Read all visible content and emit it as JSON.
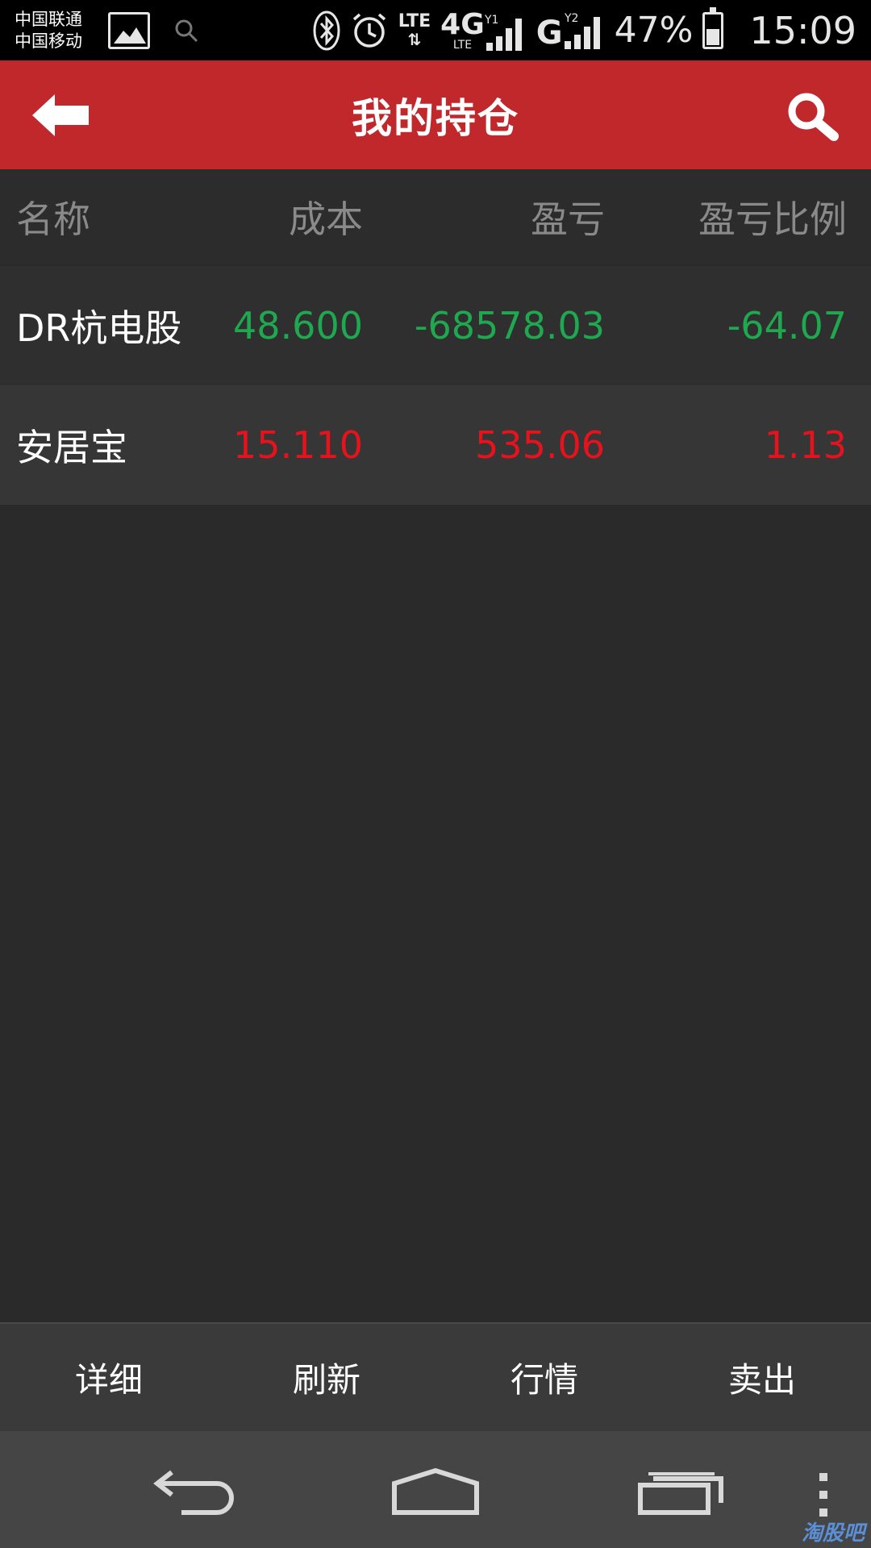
{
  "status_bar": {
    "carrier1": "中国联通",
    "carrier2": "中国移动",
    "lte_label": "LTE",
    "network_4g": "4G",
    "network_4g_sub": "LTE",
    "network_g": "G",
    "battery_percent": "47%",
    "time": "15:09"
  },
  "header": {
    "title": "我的持仓"
  },
  "columns": {
    "name": "名称",
    "cost": "成本",
    "pl": "盈亏",
    "pl_ratio": "盈亏比例"
  },
  "rows": [
    {
      "name": "DR杭电股",
      "cost": "48.600",
      "pl": "-68578.03",
      "pl_ratio": "-64.07",
      "color": "#1fa84f"
    },
    {
      "name": "安居宝",
      "cost": "15.110",
      "pl": "535.06",
      "pl_ratio": "1.13",
      "color": "#e8121c"
    }
  ],
  "actions": {
    "detail": "详细",
    "refresh": "刷新",
    "quote": "行情",
    "sell": "卖出"
  },
  "watermark": "淘股吧",
  "colors": {
    "header_red": "#c0282c",
    "gain": "#e8121c",
    "loss": "#1fa84f"
  }
}
